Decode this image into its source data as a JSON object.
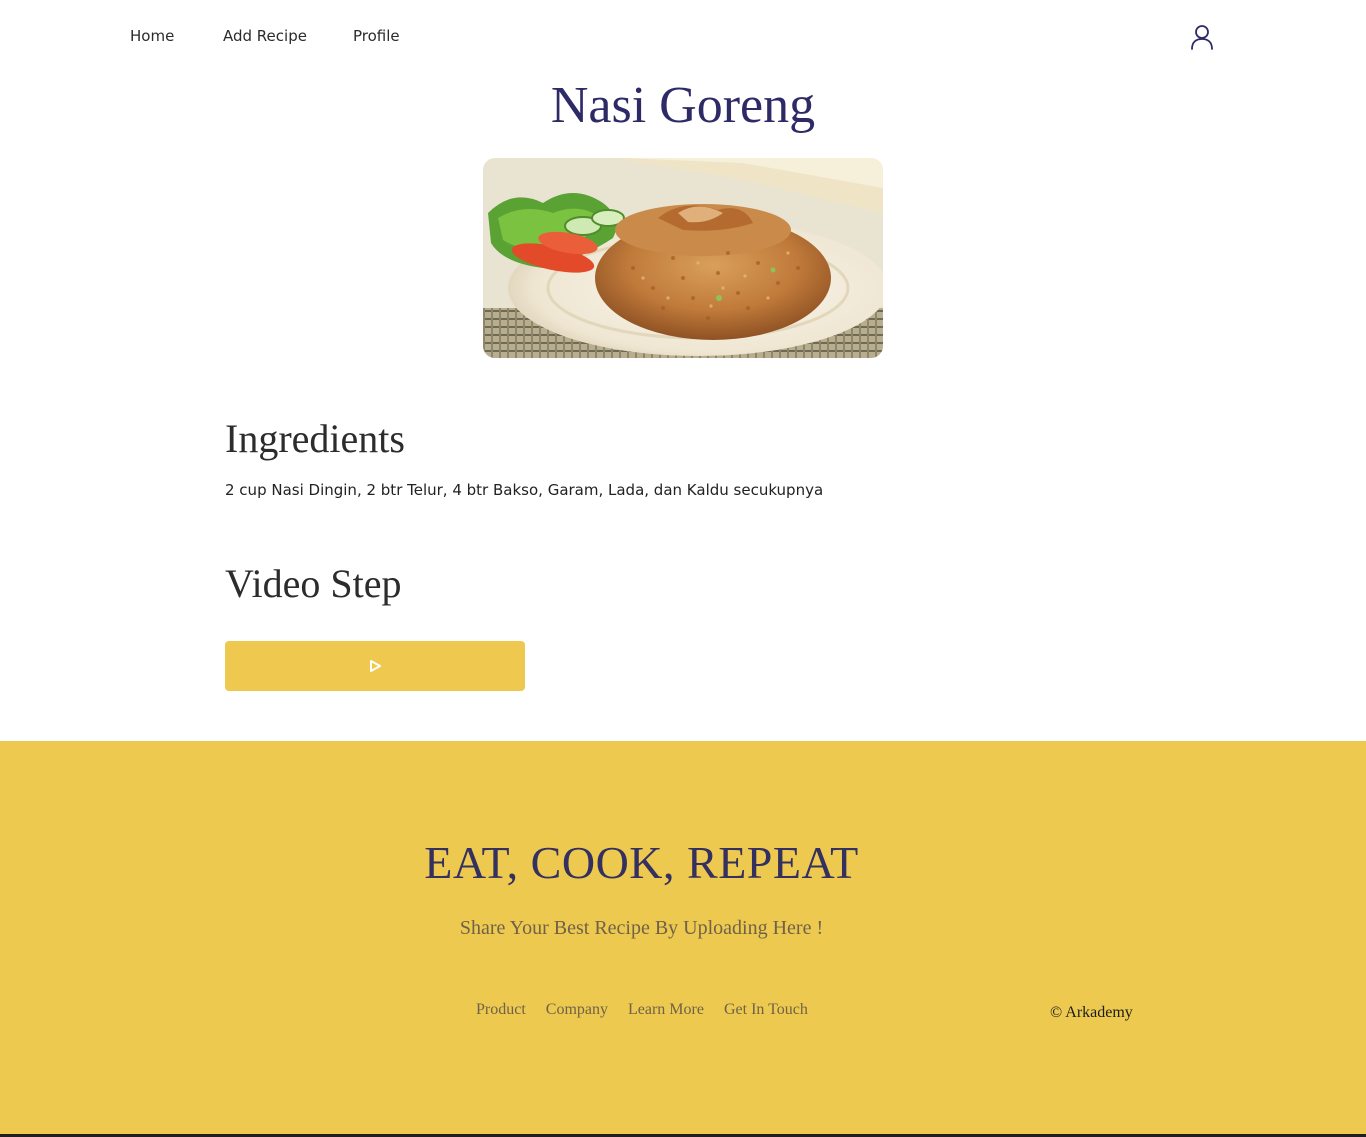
{
  "nav": {
    "home": "Home",
    "add_recipe": "Add Recipe",
    "profile": "Profile",
    "user_icon": "user-icon"
  },
  "recipe": {
    "title": "Nasi Goreng",
    "image_subject": "fried rice dish on white plate with lettuce, tomato and cucumber"
  },
  "ingredients": {
    "heading": "Ingredients",
    "text": "2 cup Nasi Dingin, 2 btr Telur, 4 btr Bakso, Garam, Lada, dan Kaldu secukupnya"
  },
  "video": {
    "heading": "Video Step",
    "play_icon": "play-icon"
  },
  "footer": {
    "headline": "EAT, COOK, REPEAT",
    "tagline": "Share Your Best Recipe By Uploading Here !",
    "links": [
      "Product",
      "Company",
      "Learn More",
      "Get In Touch"
    ],
    "copyright": "© Arkademy"
  },
  "colors": {
    "accent_yellow": "#edc950",
    "title_navy": "#2e2a66",
    "footer_text": "#6f6248"
  }
}
